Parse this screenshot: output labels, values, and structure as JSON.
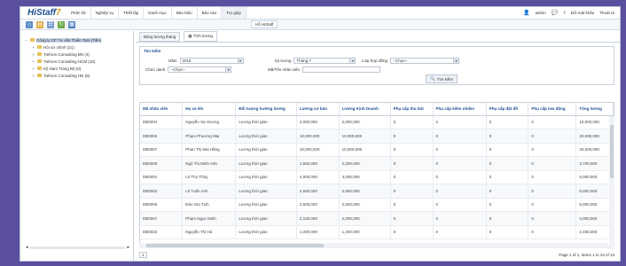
{
  "brand": {
    "name": "HiStaff",
    "version": "7"
  },
  "menu": [
    "Phân hệ",
    "Nghiệp vụ",
    "Thiết lập",
    "Danh mục",
    "Bảo biểu",
    "Báo cáo",
    "Trợ giúp"
  ],
  "active_menu_tooltip": "Hỗ HiStaff",
  "topright": {
    "user": "admin",
    "notif": "7",
    "change_pw": "Đổi mật khẩu",
    "logout": "Thoát ra"
  },
  "tree": [
    {
      "label": "Công ty CP Tư vấn Thiên Tam (Tiến)",
      "level": 0,
      "selected": true
    },
    {
      "label": "Hội sở chính (21)",
      "level": 1
    },
    {
      "label": "Tiehron Consulting BN (4)",
      "level": 1
    },
    {
      "label": "Tiehron Consulting HCM (10)",
      "level": 1
    },
    {
      "label": "Kỹ Nam Trang Bộ (0)",
      "level": 1
    },
    {
      "label": "Tiehron Consulting HN (9)",
      "level": 1
    }
  ],
  "tabs": [
    "Bảng lương tháng",
    "Tính lương"
  ],
  "search": {
    "legend": "Tìm kiếm",
    "year_label": "Năm",
    "year_value": "2015",
    "period_label": "Kỳ lương",
    "period_value": "Tháng 7",
    "contract_label": "Loại hợp đồng",
    "contract_value": "--Chọn--",
    "position_label": "Chức danh",
    "position_value": "--Chọn--",
    "emp_label": "Mã/Tên nhân viên",
    "emp_value": "",
    "button": "Tìm kiếm"
  },
  "columns": [
    "Mã nhân viên",
    "Họ và tên",
    "Đối tượng hưởng lương",
    "Lương cơ bản",
    "Lương Kinh Doanh",
    "Phụ cấp thu hút",
    "Phụ cấp kiêm nhiệm",
    "Phụ cấp đặt đồ",
    "Phụ cấp lưu động",
    "Tổng lương"
  ],
  "rows": [
    [
      "DB0004",
      "Nguyễn Sa Hương",
      "Lương thời gian",
      "2,000,000",
      "2,000,000",
      "0",
      "0",
      "0",
      "0",
      "10,000,000"
    ],
    [
      "DB0003",
      "Phạm Phương Mai",
      "Lương thời gian",
      "10,000,000",
      "10,000,000",
      "0",
      "0",
      "0",
      "0",
      "20,000,000"
    ],
    [
      "DB0007",
      "Phan Thị Mai Hằng",
      "Lương thời gian",
      "10,000,000",
      "10,000,000",
      "0",
      "0",
      "0",
      "0",
      "20,000,000"
    ],
    [
      "DB0000",
      "Ngô Thị Minh Anh",
      "Lương thời gian",
      "1,500,000",
      "2,200,000",
      "0",
      "0",
      "0",
      "0",
      "3,700,000"
    ],
    [
      "DB0001",
      "Lê Thu Thủy",
      "Lương thời gian",
      "4,000,000",
      "4,000,000",
      "0",
      "0",
      "0",
      "0",
      "8,000,000"
    ],
    [
      "DB0002",
      "Lê Tuấn Anh",
      "Lương thời gian",
      "2,500,000",
      "2,500,000",
      "0",
      "0",
      "0",
      "0",
      "5,000,000"
    ],
    [
      "DB0006",
      "Đào Gia Tịnh",
      "Lương thời gian",
      "2,500,000",
      "2,500,000",
      "0",
      "0",
      "0",
      "0",
      "5,000,000"
    ],
    [
      "DB0007",
      "Phạm Ngọc Minh",
      "Lương thời gian",
      "2,100,000",
      "2,000,000",
      "0",
      "0",
      "0",
      "0",
      "4,000,000"
    ],
    [
      "DB0022",
      "Nguyễn Thị Hà",
      "Lương thời gian",
      "1,200,000",
      "1,200,000",
      "0",
      "0",
      "0",
      "0",
      "2,400,000"
    ]
  ],
  "pager": {
    "page": "1",
    "info": "Page 1 of 1, Items 1 to 13 of 13"
  }
}
